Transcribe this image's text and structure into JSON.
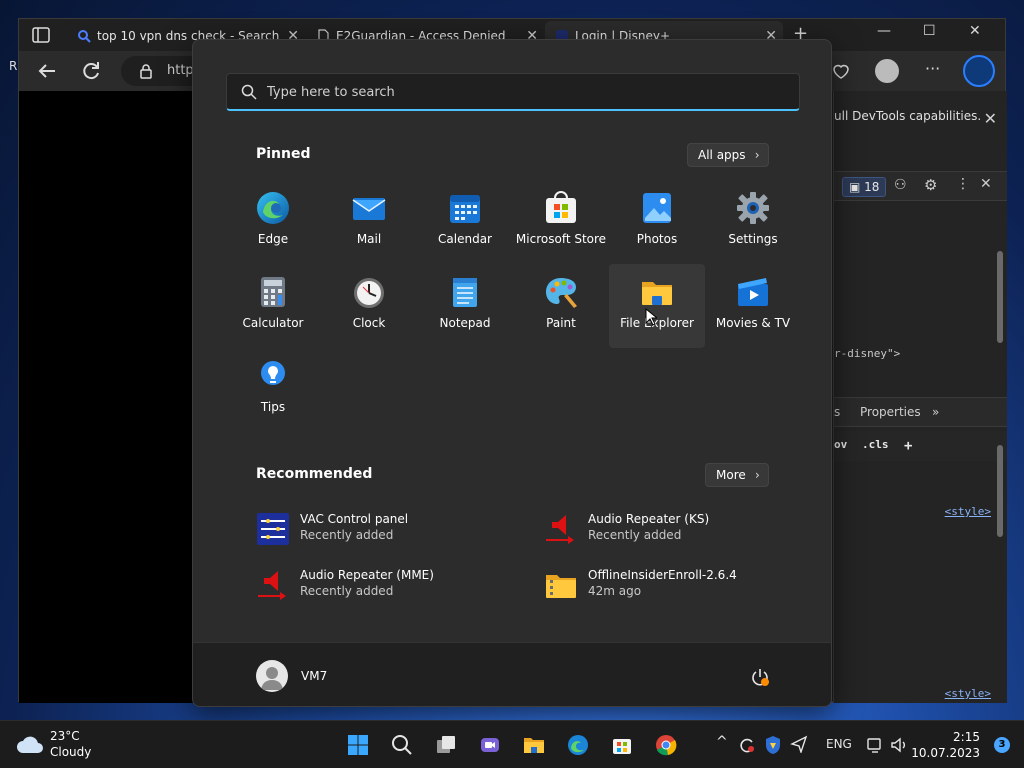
{
  "browser": {
    "tabs": [
      {
        "title": "top 10 vpn dns check - Search"
      },
      {
        "title": "E2Guardian - Access Denied"
      },
      {
        "title": "Login | Disney+"
      }
    ],
    "address": "http",
    "devtools_message": "ull DevTools capabilities.",
    "issues_count": "18",
    "code_snippet": "r-disney\">",
    "devtools_tab": "Properties",
    "styles_toolbar": {
      "hov": "ov",
      "cls": ".cls"
    },
    "style_link": "<style>",
    "side_tab_fragment": "s",
    "left_letter": "R"
  },
  "start_menu": {
    "search_placeholder": "Type here to search",
    "pinned_title": "Pinned",
    "all_apps_label": "All apps",
    "pinned": [
      {
        "label": "Edge",
        "icon": "edge-icon"
      },
      {
        "label": "Mail",
        "icon": "mail-icon"
      },
      {
        "label": "Calendar",
        "icon": "calendar-icon"
      },
      {
        "label": "Microsoft Store",
        "icon": "store-icon"
      },
      {
        "label": "Photos",
        "icon": "photos-icon"
      },
      {
        "label": "Settings",
        "icon": "settings-icon"
      },
      {
        "label": "Calculator",
        "icon": "calculator-icon"
      },
      {
        "label": "Clock",
        "icon": "clock-icon"
      },
      {
        "label": "Notepad",
        "icon": "notepad-icon"
      },
      {
        "label": "Paint",
        "icon": "paint-icon"
      },
      {
        "label": "File Explorer",
        "icon": "folder-icon"
      },
      {
        "label": "Movies & TV",
        "icon": "movies-icon"
      },
      {
        "label": "Tips",
        "icon": "tips-icon"
      }
    ],
    "recommended_title": "Recommended",
    "more_label": "More",
    "recommended": [
      {
        "name": "VAC Control panel",
        "detail": "Recently added"
      },
      {
        "name": "Audio Repeater (KS)",
        "detail": "Recently added"
      },
      {
        "name": "Audio Repeater (MME)",
        "detail": "Recently added"
      },
      {
        "name": "OfflineInsiderEnroll-2.6.4",
        "detail": "42m ago"
      }
    ],
    "user_name": "VM7"
  },
  "taskbar": {
    "temperature": "23°C",
    "condition": "Cloudy",
    "language": "ENG",
    "time": "2:15",
    "date": "10.07.2023",
    "notification_count": "3"
  },
  "colors": {
    "accent": "#4cc2ff",
    "start_bg": "#2c2c2c"
  }
}
